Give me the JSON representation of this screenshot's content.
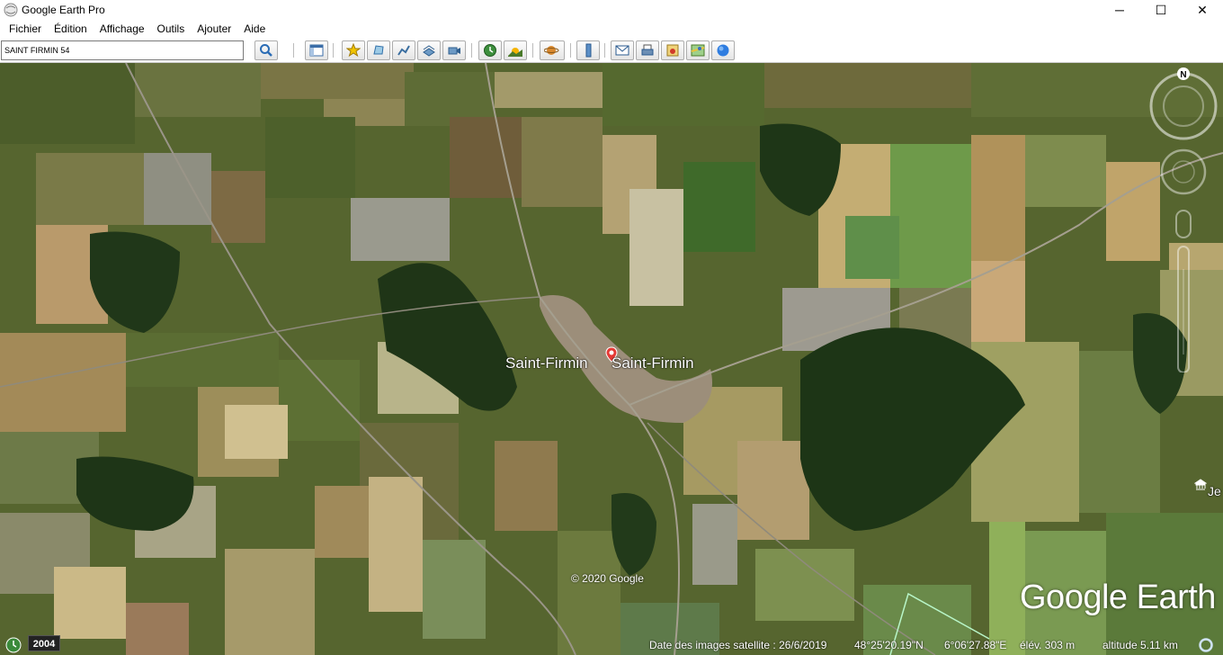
{
  "window": {
    "title": "Google Earth Pro",
    "minimize": "─",
    "maximize": "☐",
    "close": "✕"
  },
  "menu": [
    "Fichier",
    "Édition",
    "Affichage",
    "Outils",
    "Ajouter",
    "Aide"
  ],
  "search": {
    "value": "SAINT FIRMIN 54"
  },
  "toolbar_icons": [
    "search-icon",
    "sidebar-toggle-icon",
    "placemark-icon",
    "polygon-icon",
    "path-icon",
    "overlay-icon",
    "tour-icon",
    "historical-imagery-icon",
    "sunlight-icon",
    "planets-icon",
    "ruler-icon",
    "email-icon",
    "print-icon",
    "save-image-icon",
    "maps-icon",
    "earth-icon"
  ],
  "map": {
    "labels": [
      "Saint-Firmin",
      "Saint-Firmin"
    ],
    "edge_label": "Je",
    "copyright": "© 2020 Google",
    "logo": "Google Earth",
    "compass_north": "N"
  },
  "status": {
    "imagery_year": "2004",
    "imagery_date": "Date des images satellite : 26/6/2019",
    "latitude": "48°25'20.19\"N",
    "longitude": "6°06'27.88\"E",
    "elevation": "élév.  303 m",
    "altitude": "altitude    5.11 km"
  }
}
